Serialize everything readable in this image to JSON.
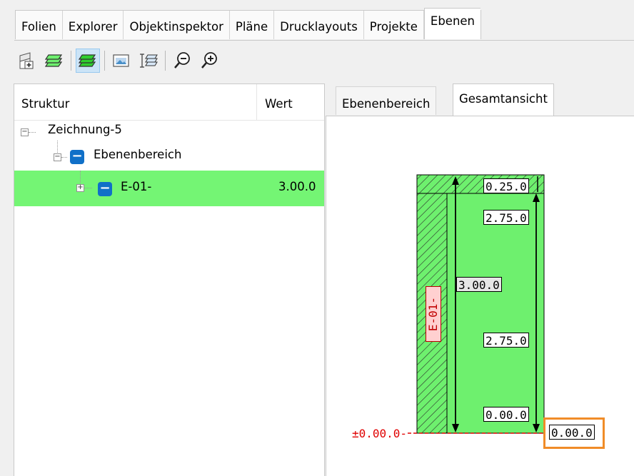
{
  "tabs": [
    "Folien",
    "Explorer",
    "Objektinspektor",
    "Pläne",
    "Drucklayouts",
    "Projekte",
    "Ebenen"
  ],
  "active_tab": "Ebenen",
  "toolbar": {
    "buttons": [
      "new-level-icon",
      "layers-icon",
      "layers-active-icon",
      "image-icon",
      "layer-settings-icon",
      "zoom-out-icon",
      "zoom-in-icon"
    ]
  },
  "tree": {
    "col_struktur": "Struktur",
    "col_wert": "Wert",
    "nodes": [
      {
        "label": "Zeichnung-5",
        "value": ""
      },
      {
        "label": "Ebenenbereich",
        "value": ""
      },
      {
        "label": "E-01-",
        "value": "3.00.0"
      }
    ]
  },
  "view_tabs": [
    "Ebenenbereich",
    "Gesamtansicht"
  ],
  "active_view_tab": "Gesamtansicht",
  "drawing": {
    "level_name": "E-01-",
    "top_dim": "0.25.0",
    "upper_dim": "2.75.0",
    "total_dim": "3.00.0",
    "lower_dim": "2.75.0",
    "base_dim": "0.00.0",
    "ground_label": "±0.00.0-",
    "selected_value": "0.00.0"
  },
  "colors": {
    "selection_green": "#74f574",
    "level_fill": "#6ef06e",
    "badge_blue": "#1070c8",
    "ground_red": "#e00000",
    "highlight_orange": "#f08c28"
  }
}
